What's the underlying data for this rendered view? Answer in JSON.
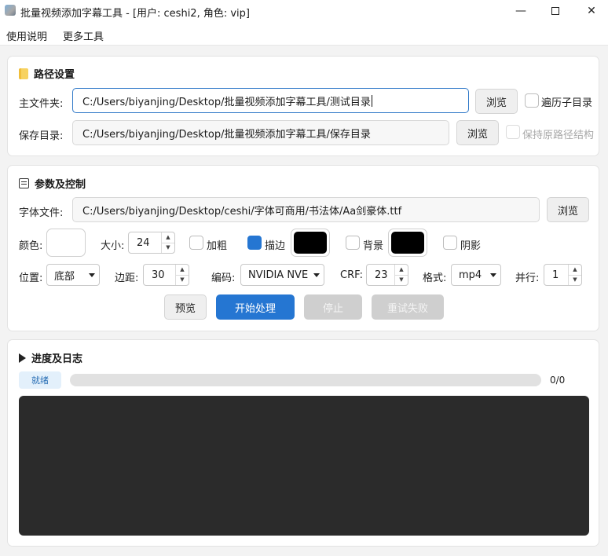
{
  "window": {
    "title": "批量视频添加字幕工具 - [用户: ceshi2, 角色: vip]",
    "minimize": "—",
    "close": "✕"
  },
  "menu": [
    "使用说明",
    "更多工具"
  ],
  "paths": {
    "title": "路径设置",
    "main_label": "主文件夹:",
    "main_value": "C:/Users/biyanjing/Desktop/批量视频添加字幕工具/测试目录",
    "browse": "浏览",
    "recurse_label": "遍历子目录",
    "recurse_checked": false,
    "save_label": "保存目录:",
    "save_value": "C:/Users/biyanjing/Desktop/批量视频添加字幕工具/保存目录",
    "keep_structure_label": "保持原路径结构",
    "keep_structure_checked": false
  },
  "params": {
    "title": "参数及控制",
    "font_label": "字体文件:",
    "font_value": "C:/Users/biyanjing/Desktop/ceshi/字体可商用/书法体/Aa剑豪体.ttf",
    "browse": "浏览",
    "color_label": "颜色:",
    "color_value": "#ffffff",
    "size_label": "大小:",
    "size_value": "24",
    "bold_label": "加粗",
    "bold_checked": false,
    "outline_label": "描边",
    "outline_checked": true,
    "outline_color": "#000000",
    "bg_label": "背景",
    "bg_checked": false,
    "bg_color": "#000000",
    "shadow_label": "阴影",
    "shadow_checked": false,
    "position_label": "位置:",
    "position_value": "底部",
    "margin_label": "边距:",
    "margin_value": "30",
    "codec_label": "编码:",
    "codec_value": "NVIDIA NVE",
    "crf_label": "CRF:",
    "crf_value": "23",
    "format_label": "格式:",
    "format_value": "mp4",
    "parallel_label": "并行:",
    "parallel_value": "1",
    "preview_button": "预览",
    "start_button": "开始处理",
    "stop_button": "停止",
    "retry_button": "重试失败"
  },
  "progress": {
    "title": "进度及日志",
    "status": "就绪",
    "fraction": 0,
    "count_text": "0/0",
    "log_text": ""
  }
}
